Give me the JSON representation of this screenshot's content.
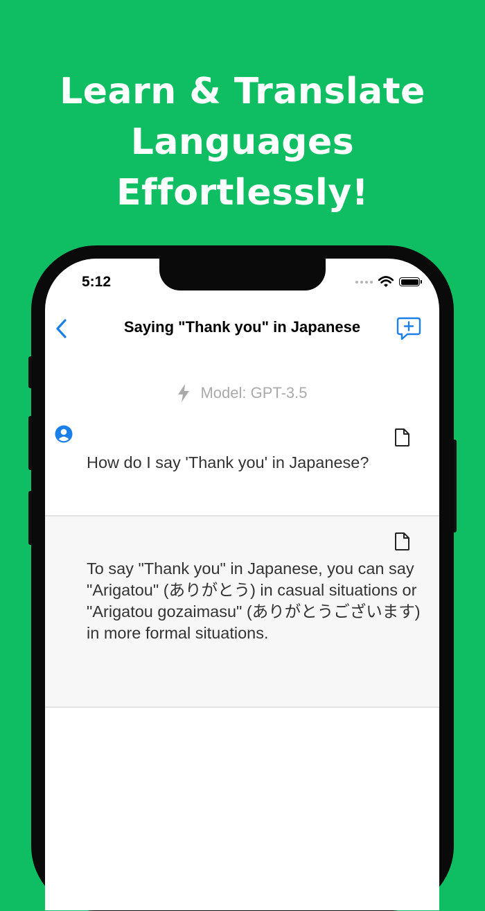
{
  "headline": {
    "line1": "Learn & Translate",
    "line2": "Languages",
    "line3": "Effortlessly!"
  },
  "status_bar": {
    "time": "5:12",
    "icons": [
      "cellular-dots-icon",
      "wifi-icon",
      "battery-icon"
    ]
  },
  "nav": {
    "title": "Saying \"Thank you\" in Japanese",
    "back_icon": "chevron-left-icon",
    "new_chat_icon": "chat-plus-icon"
  },
  "model": {
    "icon": "lightning-icon",
    "label": "Model: GPT-3.5"
  },
  "messages": [
    {
      "role": "user",
      "icon": "user-avatar-icon",
      "copy_icon": "document-icon",
      "text": "How do I say 'Thank you' in Japanese?"
    },
    {
      "role": "assistant",
      "copy_icon": "document-icon",
      "text": "To say \"Thank you\" in Japanese, you can say \"Arigatou\" (ありがとう) in casual situations or \"Arigatou gozaimasu\" (ありがとうございます) in more formal situations."
    }
  ],
  "colors": {
    "background": "#0fbe63",
    "accent": "#1a7fe8",
    "text": "#333333",
    "muted": "#aaaaaa"
  }
}
